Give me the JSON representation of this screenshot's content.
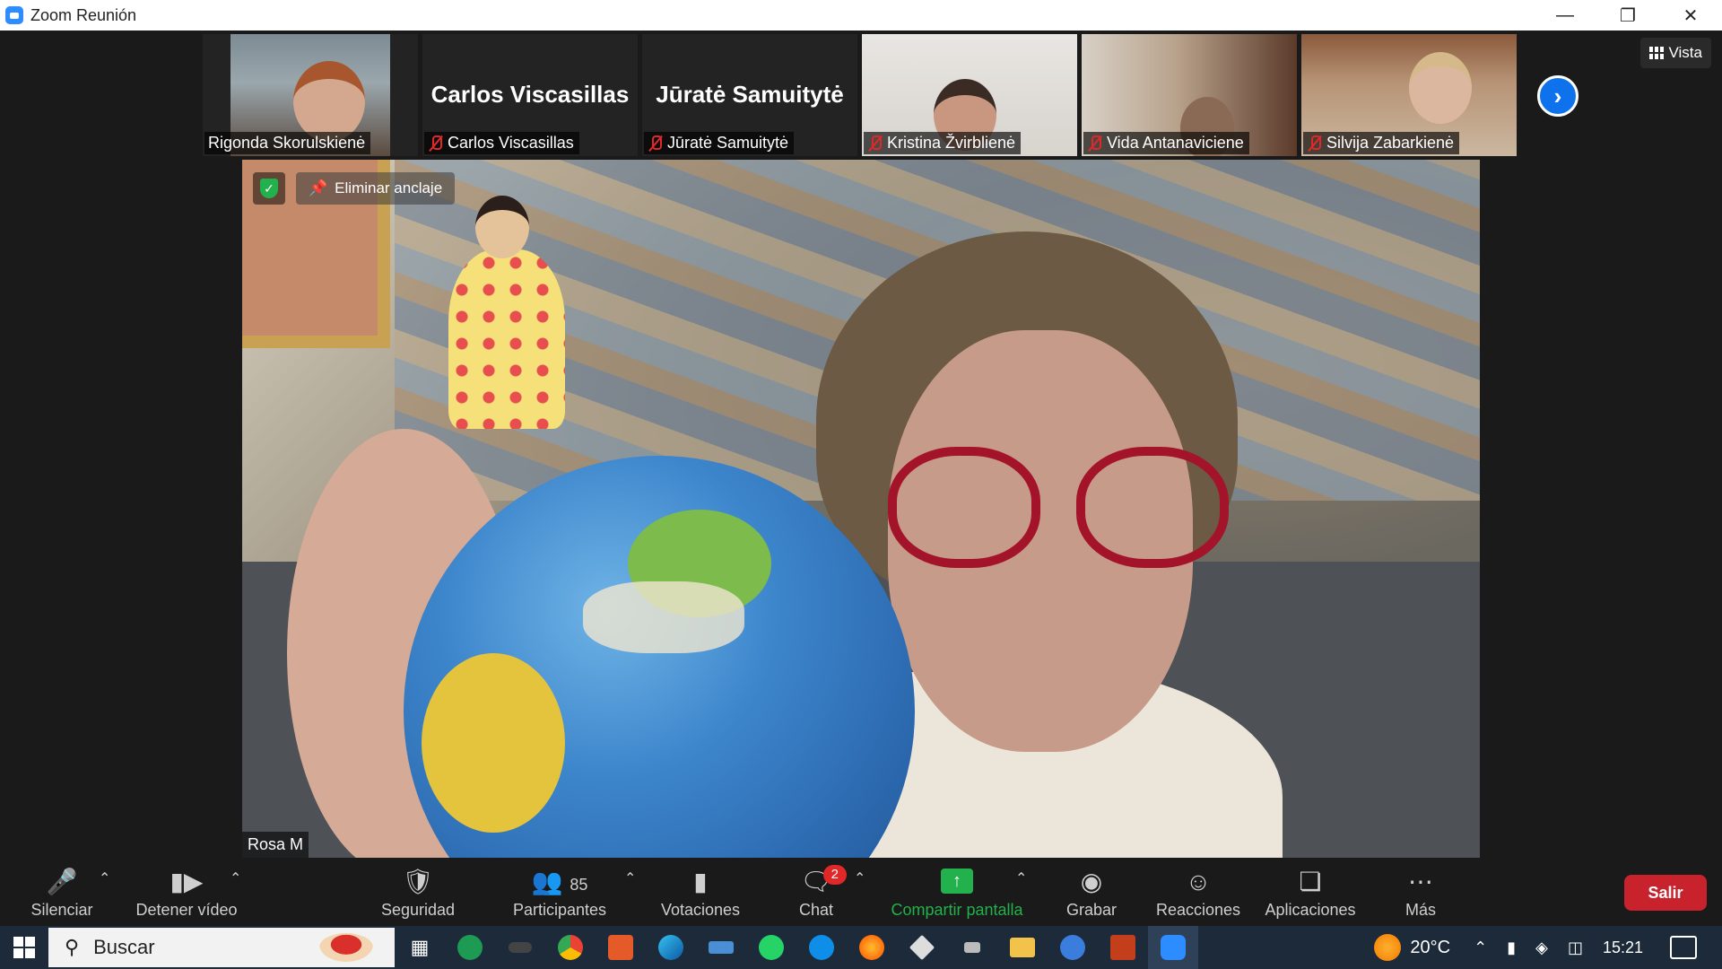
{
  "window": {
    "title": "Zoom Reunión"
  },
  "gallery": {
    "tiles": [
      {
        "name": "Rigonda Skorulskienė",
        "muted": false,
        "video": true
      },
      {
        "name": "Carlos Viscasillas",
        "muted": true,
        "video": false
      },
      {
        "name": "Jūratė Samuitytė",
        "muted": true,
        "video": false
      },
      {
        "name": "Kristina Žvirblienė",
        "muted": true,
        "video": true
      },
      {
        "name": "Vida Antanaviciene",
        "muted": true,
        "video": true
      },
      {
        "name": "Silvija Zabarkienė",
        "muted": true,
        "video": true
      }
    ],
    "view_label": "Vista"
  },
  "speaker": {
    "name": "Rosa M",
    "unpin_label": "Eliminar anclaje"
  },
  "toolbar": {
    "mute_label": "Silenciar",
    "video_label": "Detener vídeo",
    "security_label": "Seguridad",
    "participants_label": "Participantes",
    "participants_count": "85",
    "polls_label": "Votaciones",
    "chat_label": "Chat",
    "chat_badge": "2",
    "share_label": "Compartir pantalla",
    "record_label": "Grabar",
    "reactions_label": "Reacciones",
    "apps_label": "Aplicaciones",
    "more_label": "Más",
    "leave_label": "Salir",
    "share_color": "#22b14c",
    "leave_color": "#c8232c"
  },
  "taskbar": {
    "search_placeholder": "Buscar",
    "weather": "20°C",
    "time": "15:21"
  }
}
